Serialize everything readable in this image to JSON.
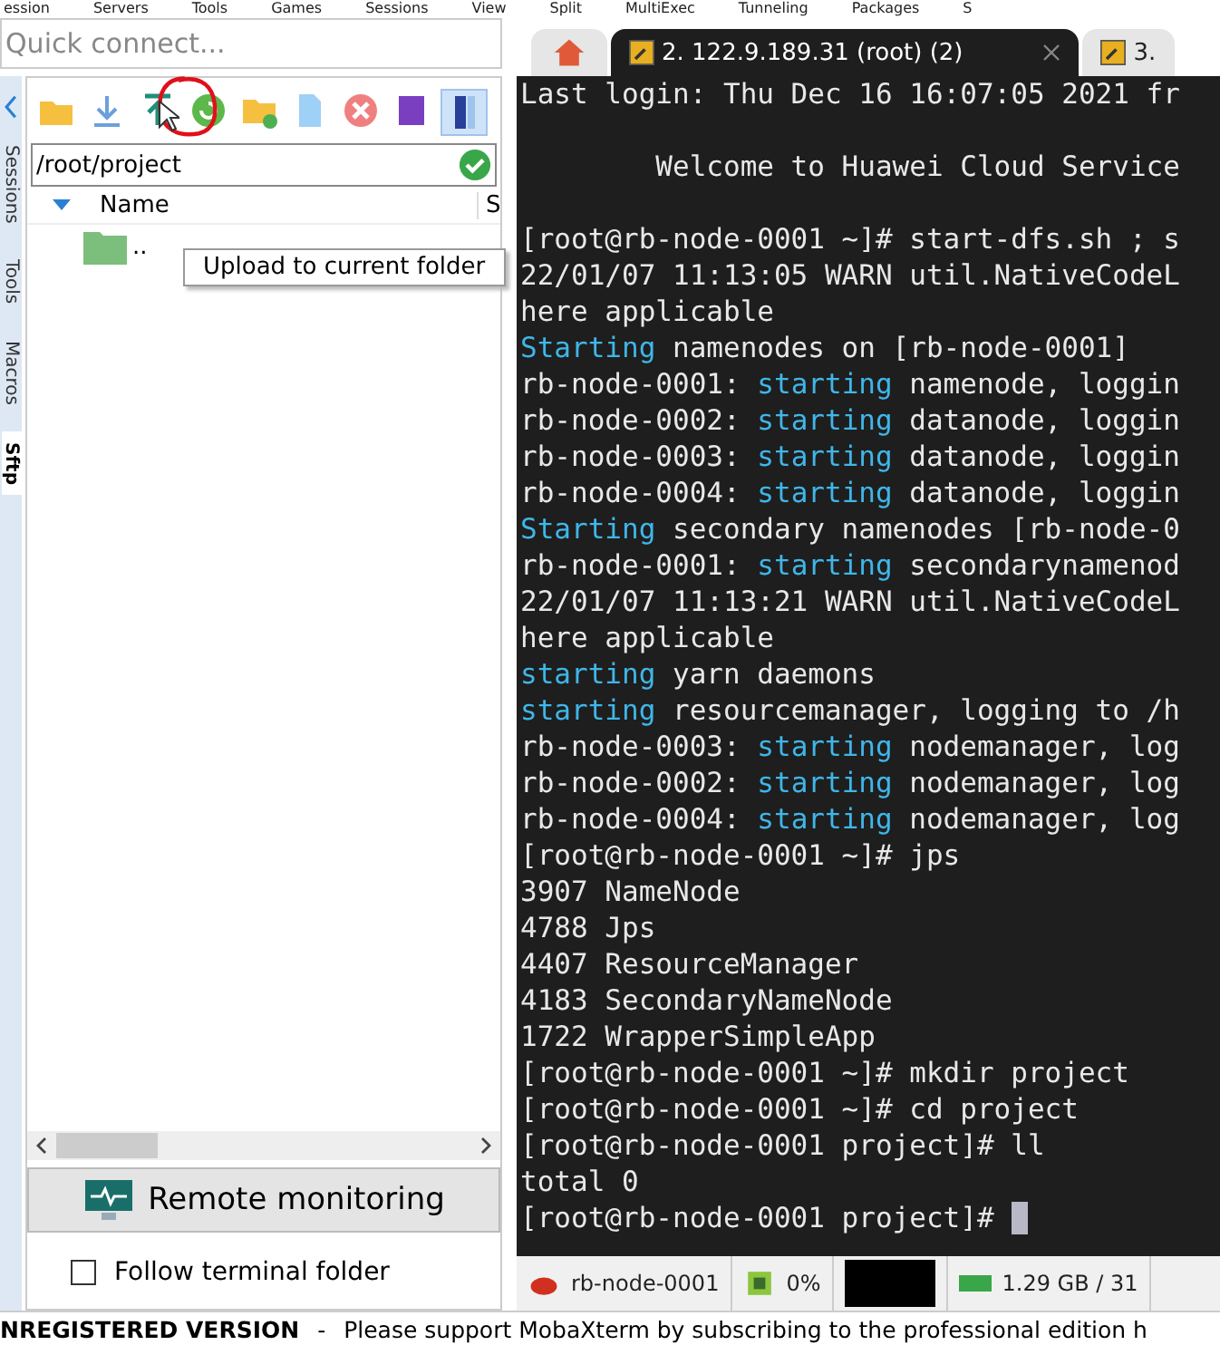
{
  "menu": [
    "ession",
    "Servers",
    "Tools",
    "Games",
    "Sessions",
    "View",
    "Split",
    "MultiExec",
    "Tunneling",
    "Packages",
    "S"
  ],
  "quick_connect": {
    "placeholder": "Quick connect..."
  },
  "side_tabs": [
    {
      "label": "Sessions",
      "selected": false
    },
    {
      "label": "Tools",
      "selected": false
    },
    {
      "label": "Macros",
      "selected": false
    },
    {
      "label": "Sftp",
      "selected": true
    }
  ],
  "sftp": {
    "path": "/root/project",
    "columns": [
      "Name",
      "S"
    ],
    "rows": [
      ".."
    ],
    "tooltip": "Upload to current folder",
    "remote_monitoring": "Remote monitoring",
    "follow_terminal": {
      "label": "Follow terminal folder",
      "checked": false
    }
  },
  "terminal_tabs": [
    {
      "kind": "home",
      "selected": false
    },
    {
      "kind": "session",
      "label": "2. 122.9.189.31 (root) (2)",
      "selected": true
    },
    {
      "kind": "session",
      "label": "3.",
      "selected": false
    }
  ],
  "terminal_lines": [
    [
      {
        "text": "Last login: Thu Dec 16 16:07:05 2021 fr",
        "highlight": false
      }
    ],
    {
      "kind": "blank"
    },
    [
      {
        "text": "        Welcome to Huawei Cloud Service",
        "highlight": false
      }
    ],
    {
      "kind": "blank"
    },
    [
      {
        "text": "[root@rb-node-0001 ~]# start-dfs.sh ; s",
        "highlight": false
      }
    ],
    [
      {
        "text": "22/01/07 11:13:05 WARN util.NativeCodeL",
        "highlight": false
      }
    ],
    [
      {
        "text": "here applicable",
        "highlight": false
      }
    ],
    [
      {
        "text": "Starting",
        "highlight": true
      },
      {
        "text": " namenodes on [rb-node-0001]",
        "highlight": false
      }
    ],
    [
      {
        "text": "rb-node-0001: ",
        "highlight": false
      },
      {
        "text": "starting",
        "highlight": true
      },
      {
        "text": " namenode, loggin",
        "highlight": false
      }
    ],
    [
      {
        "text": "rb-node-0002: ",
        "highlight": false
      },
      {
        "text": "starting",
        "highlight": true
      },
      {
        "text": " datanode, loggin",
        "highlight": false
      }
    ],
    [
      {
        "text": "rb-node-0003: ",
        "highlight": false
      },
      {
        "text": "starting",
        "highlight": true
      },
      {
        "text": " datanode, loggin",
        "highlight": false
      }
    ],
    [
      {
        "text": "rb-node-0004: ",
        "highlight": false
      },
      {
        "text": "starting",
        "highlight": true
      },
      {
        "text": " datanode, loggin",
        "highlight": false
      }
    ],
    [
      {
        "text": "Starting",
        "highlight": true
      },
      {
        "text": " secondary namenodes [rb-node-0",
        "highlight": false
      }
    ],
    [
      {
        "text": "rb-node-0001: ",
        "highlight": false
      },
      {
        "text": "starting",
        "highlight": true
      },
      {
        "text": " secondarynamenod",
        "highlight": false
      }
    ],
    [
      {
        "text": "22/01/07 11:13:21 WARN util.NativeCodeL",
        "highlight": false
      }
    ],
    [
      {
        "text": "here applicable",
        "highlight": false
      }
    ],
    [
      {
        "text": "starting",
        "highlight": true
      },
      {
        "text": " yarn daemons",
        "highlight": false
      }
    ],
    [
      {
        "text": "starting",
        "highlight": true
      },
      {
        "text": " resourcemanager, logging to /h",
        "highlight": false
      }
    ],
    [
      {
        "text": "rb-node-0003: ",
        "highlight": false
      },
      {
        "text": "starting",
        "highlight": true
      },
      {
        "text": " nodemanager, log",
        "highlight": false
      }
    ],
    [
      {
        "text": "rb-node-0002: ",
        "highlight": false
      },
      {
        "text": "starting",
        "highlight": true
      },
      {
        "text": " nodemanager, log",
        "highlight": false
      }
    ],
    [
      {
        "text": "rb-node-0004: ",
        "highlight": false
      },
      {
        "text": "starting",
        "highlight": true
      },
      {
        "text": " nodemanager, log",
        "highlight": false
      }
    ],
    [
      {
        "text": "[root@rb-node-0001 ~]# jps",
        "highlight": false
      }
    ],
    [
      {
        "text": "3907 NameNode",
        "highlight": false
      }
    ],
    [
      {
        "text": "4788 Jps",
        "highlight": false
      }
    ],
    [
      {
        "text": "4407 ResourceManager",
        "highlight": false
      }
    ],
    [
      {
        "text": "4183 SecondaryNameNode",
        "highlight": false
      }
    ],
    [
      {
        "text": "1722 WrapperSimpleApp",
        "highlight": false
      }
    ],
    [
      {
        "text": "[root@rb-node-0001 ~]# mkdir project",
        "highlight": false
      }
    ],
    [
      {
        "text": "[root@rb-node-0001 ~]# cd project",
        "highlight": false
      }
    ],
    [
      {
        "text": "[root@rb-node-0001 project]# ll",
        "highlight": false
      }
    ],
    [
      {
        "text": "total 0",
        "highlight": false
      }
    ],
    [
      {
        "text": "[root@rb-node-0001 project]# ",
        "highlight": false
      }
    ]
  ],
  "status_bar": [
    {
      "kind": "host",
      "text": "rb-node-0001"
    },
    {
      "kind": "cpu",
      "text": "0%"
    },
    {
      "kind": "graph"
    },
    {
      "kind": "memory",
      "text": "1.29 GB / 31"
    }
  ],
  "footer": {
    "title": "NREGISTERED VERSION",
    "separator": "-",
    "message": "Please support MobaXterm by subscribing to the professional edition h"
  }
}
